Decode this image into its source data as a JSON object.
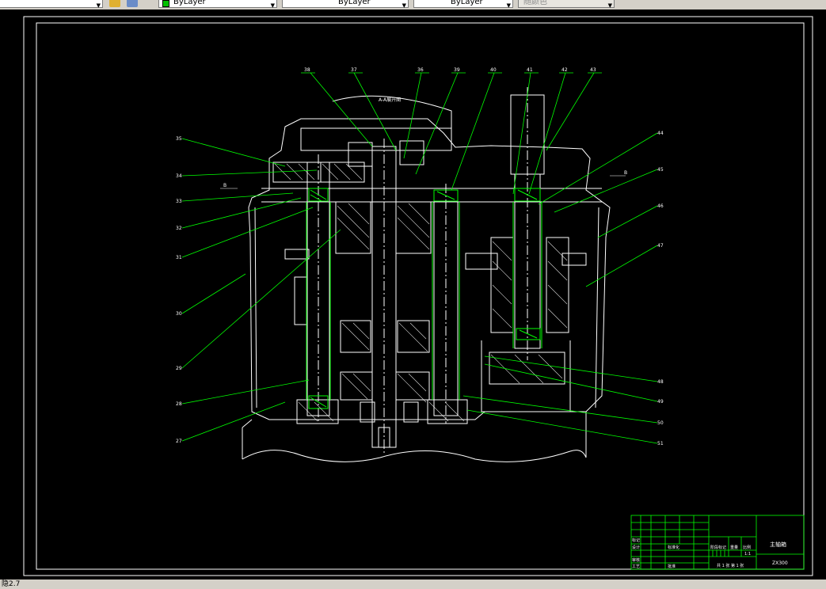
{
  "toolbar": {
    "color_value": "ByLayer",
    "linetype_value": "ByLayer",
    "lineweight_value": "ByLayer",
    "plotstyle_value": "随颜色"
  },
  "drawing": {
    "section_label": "A-A展开图",
    "b_label": "B",
    "callouts_top": [
      "38",
      "37",
      "36",
      "39",
      "40",
      "41",
      "42",
      "43"
    ],
    "callouts_left": [
      "35",
      "34",
      "33",
      "32",
      "31",
      "30",
      "29",
      "28",
      "27"
    ],
    "callouts_right": [
      "44",
      "45",
      "46",
      "47",
      "48",
      "49",
      "50",
      "51"
    ]
  },
  "title_block": {
    "drawing_name": "主轴箱",
    "drawing_number": "ZX300",
    "scale": "1:1",
    "sheet_info": "共 1 张  第 1 张",
    "mass_label": "重量",
    "scale_label": "比例",
    "stage_label": "阶段标记",
    "rows": [
      "标记",
      "设计",
      "审核",
      "工艺"
    ],
    "std_label": "标准化",
    "approve_label": "批准"
  },
  "status": {
    "text": "隐2.7"
  },
  "colors": {
    "background": "#000000",
    "line_white": "#ffffff",
    "line_green": "#00ff00",
    "hatch_green": "#00cc00",
    "toolbar_bg": "#d4d0c8"
  }
}
